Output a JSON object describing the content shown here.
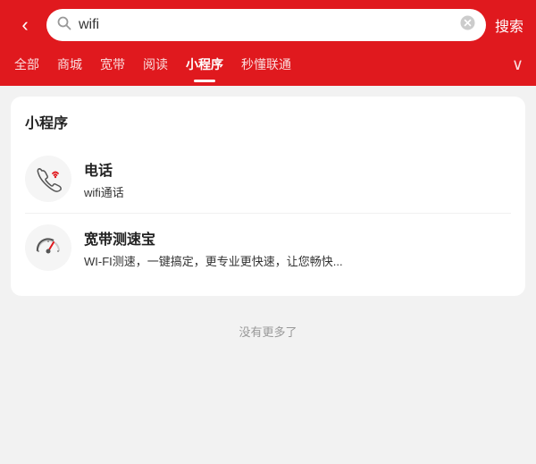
{
  "header": {
    "back_icon": "‹",
    "search_query": "wifi",
    "clear_icon": "✕",
    "search_button_label": "搜索"
  },
  "tabs": [
    {
      "id": "all",
      "label": "全部",
      "active": false
    },
    {
      "id": "mall",
      "label": "商城",
      "active": false
    },
    {
      "id": "broadband",
      "label": "宽带",
      "active": false
    },
    {
      "id": "reading",
      "label": "阅读",
      "active": false
    },
    {
      "id": "miniapp",
      "label": "小程序",
      "active": true
    },
    {
      "id": "understand",
      "label": "秒懂联通",
      "active": false
    }
  ],
  "tabs_more_icon": "∨",
  "section": {
    "title": "小程序",
    "items": [
      {
        "id": "phone",
        "name": "电话",
        "desc_highlight": "wifi",
        "desc_rest": "通话",
        "icon": "phone"
      },
      {
        "id": "speedtest",
        "name": "宽带测速宝",
        "desc_highlight": "WI-FI",
        "desc_rest": "测速，一键搞定，更专业更快速，让您畅快...",
        "icon": "speedometer"
      }
    ]
  },
  "no_more_label": "没有更多了"
}
